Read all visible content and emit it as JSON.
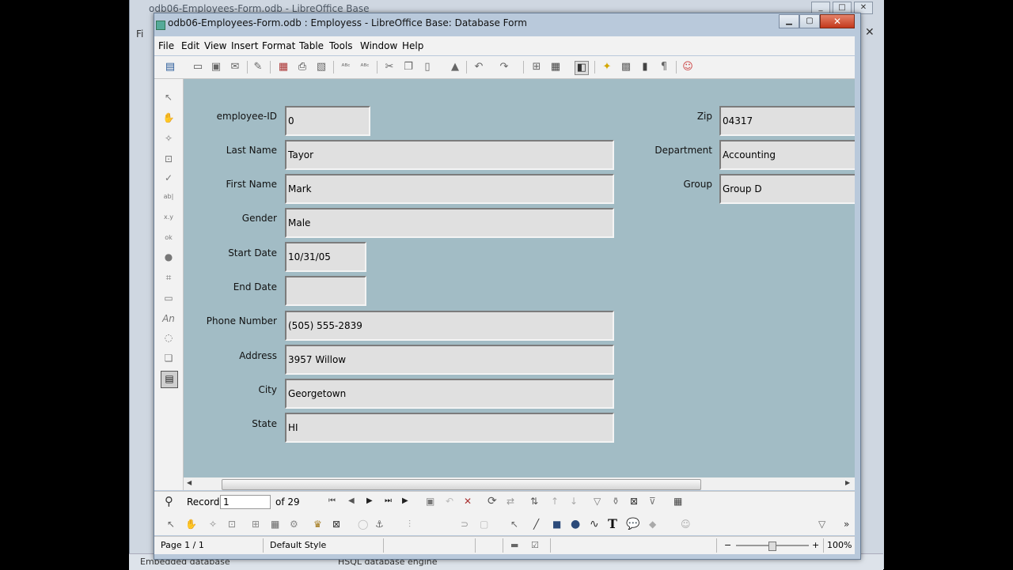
{
  "background_window": {
    "title": "odb06-Employees-Form.odb - LibreOffice Base",
    "menu_fragment": "Fi",
    "close": "✕",
    "status": {
      "left": "Embedded database",
      "right": "HSQL database engine"
    }
  },
  "window": {
    "title": "odb06-Employees-Form.odb : Employess - LibreOffice Base: Database Form",
    "min": "▁",
    "max": "▢",
    "close": "✕"
  },
  "menu": [
    "File",
    "Edit",
    "View",
    "Insert",
    "Format",
    "Table",
    "Tools",
    "Window",
    "Help"
  ],
  "form": {
    "labels": {
      "employee_id": "employee-ID",
      "last_name": "Last Name",
      "first_name": "First Name",
      "gender": "Gender",
      "start_date": "Start Date",
      "end_date": "End Date",
      "phone": "Phone Number",
      "address": "Address",
      "city": "City",
      "state": "State",
      "zip": "Zip",
      "department": "Department",
      "group": "Group"
    },
    "values": {
      "employee_id": "0",
      "last_name": "Tayor",
      "first_name": "Mark",
      "gender": "Male",
      "start_date": "10/31/05",
      "end_date": "",
      "phone": "(505) 555-2839",
      "address": "3957 Willow",
      "city": "Georgetown",
      "state": "HI",
      "zip": "04317",
      "department": "Accounting",
      "group": "Group D"
    },
    "background_color": "#a2bcc5"
  },
  "navigation": {
    "record_label": "Record",
    "record_value": "1",
    "of_label": "of 29"
  },
  "status": {
    "page": "Page 1 / 1",
    "style": "Default Style",
    "zoom_minus": "−",
    "zoom_plus": "+",
    "zoom": "100%",
    "zoom_level": 1.0
  },
  "icons": {
    "toolbar": [
      "new-document-icon",
      "open-icon",
      "save-icon",
      "email-icon",
      "edit-file-icon",
      "export-pdf-icon",
      "print-icon",
      "print-preview-icon",
      "spellcheck-icon",
      "autospell-icon",
      "cut-icon",
      "copy-icon",
      "paste-icon",
      "format-paintbrush-icon",
      "undo-icon",
      "redo-icon",
      "navigator-icon",
      "table-icon",
      "design-mode-icon",
      "form-wizard-icon",
      "gallery-icon",
      "data-source-icon",
      "nonprinting-chars-icon",
      "help-agent-icon"
    ],
    "left": [
      "select-icon",
      "design-mode-icon",
      "control-wizards-icon",
      "form-navigator-icon",
      "check-box-icon",
      "text-box-icon",
      "formatted-field-icon",
      "list-box-icon",
      "option-button-icon",
      "combo-box-icon",
      "push-button-icon",
      "label-icon",
      "image-control-icon",
      "more-controls-icon",
      "form-design-icon"
    ]
  }
}
